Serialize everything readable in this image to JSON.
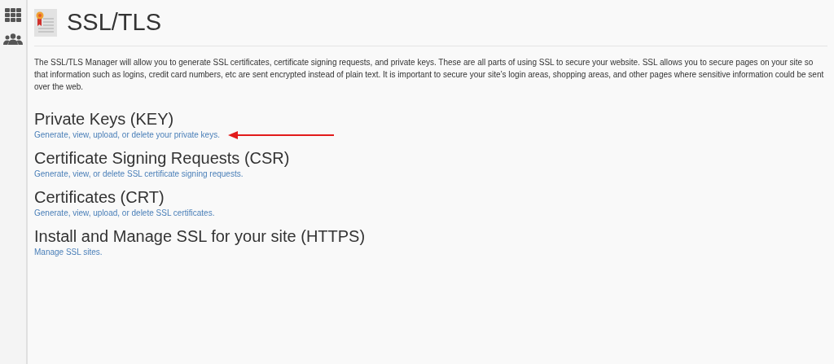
{
  "page": {
    "title": "SSL/TLS",
    "description": "The SSL/TLS Manager will allow you to generate SSL certificates, certificate signing requests, and private keys. These are all parts of using SSL to secure your website. SSL allows you to secure pages on your site so that information such as logins, credit card numbers, etc are sent encrypted instead of plain text. It is important to secure your site’s login areas, shopping areas, and other pages where sensitive information could be sent over the web."
  },
  "sections": [
    {
      "heading": "Private Keys (KEY)",
      "link": "Generate, view, upload, or delete your private keys.",
      "arrow": true
    },
    {
      "heading": "Certificate Signing Requests (CSR)",
      "link": "Generate, view, or delete SSL certificate signing requests.",
      "arrow": false
    },
    {
      "heading": "Certificates (CRT)",
      "link": "Generate, view, upload, or delete SSL certificates.",
      "arrow": false
    },
    {
      "heading": "Install and Manage SSL for your site (HTTPS)",
      "link": "Manage SSL sites.",
      "arrow": false
    }
  ]
}
